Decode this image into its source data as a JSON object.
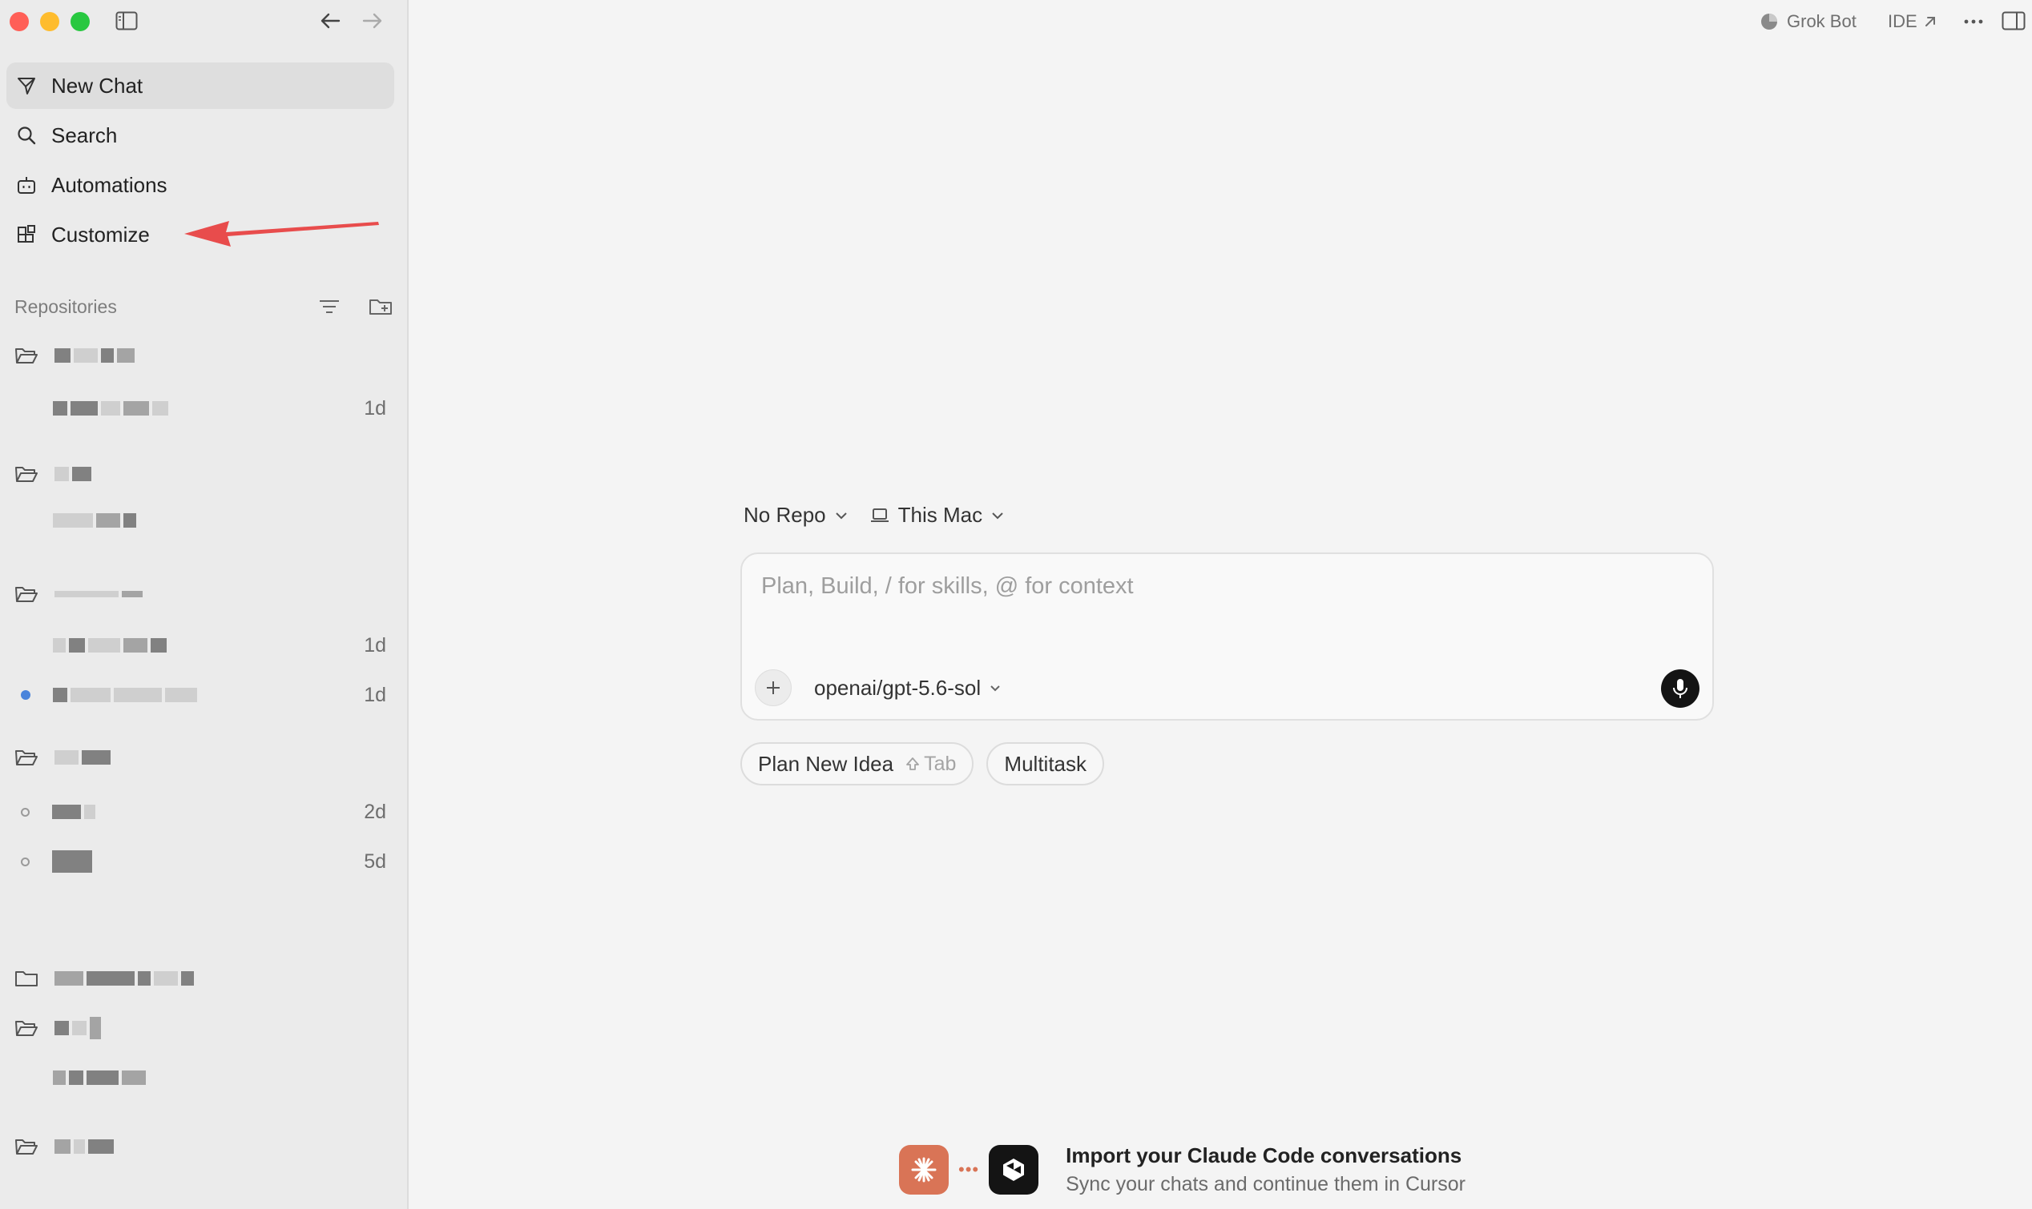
{
  "window": {
    "traffic_colors": [
      "#ff5f57",
      "#febc2e",
      "#28c840"
    ]
  },
  "sidebar": {
    "nav": [
      {
        "label": "New Chat",
        "icon": "send-icon"
      },
      {
        "label": "Search",
        "icon": "search-icon"
      },
      {
        "label": "Automations",
        "icon": "robot-icon"
      },
      {
        "label": "Customize",
        "icon": "blocks-icon"
      }
    ],
    "repositories_label": "Repositories",
    "times": [
      "1d",
      "1d",
      "1d",
      "2d",
      "5d"
    ]
  },
  "topbar": {
    "grok_label": "Grok Bot",
    "ide_label": "IDE"
  },
  "composer": {
    "repo_selector": "No Repo",
    "machine_selector": "This Mac",
    "placeholder": "Plan, Build, / for skills, @ for context",
    "model": "openai/gpt-5.6-sol"
  },
  "chips": {
    "plan_label": "Plan New Idea",
    "plan_hint": "Tab",
    "multitask_label": "Multitask"
  },
  "import_banner": {
    "title": "Import your Claude Code conversations",
    "subtitle": "Sync your chats and continue them in Cursor"
  },
  "colors": {
    "accent_blue": "#4a84db",
    "annotation_red": "#e84c4c",
    "claude_orange": "#d97456"
  }
}
